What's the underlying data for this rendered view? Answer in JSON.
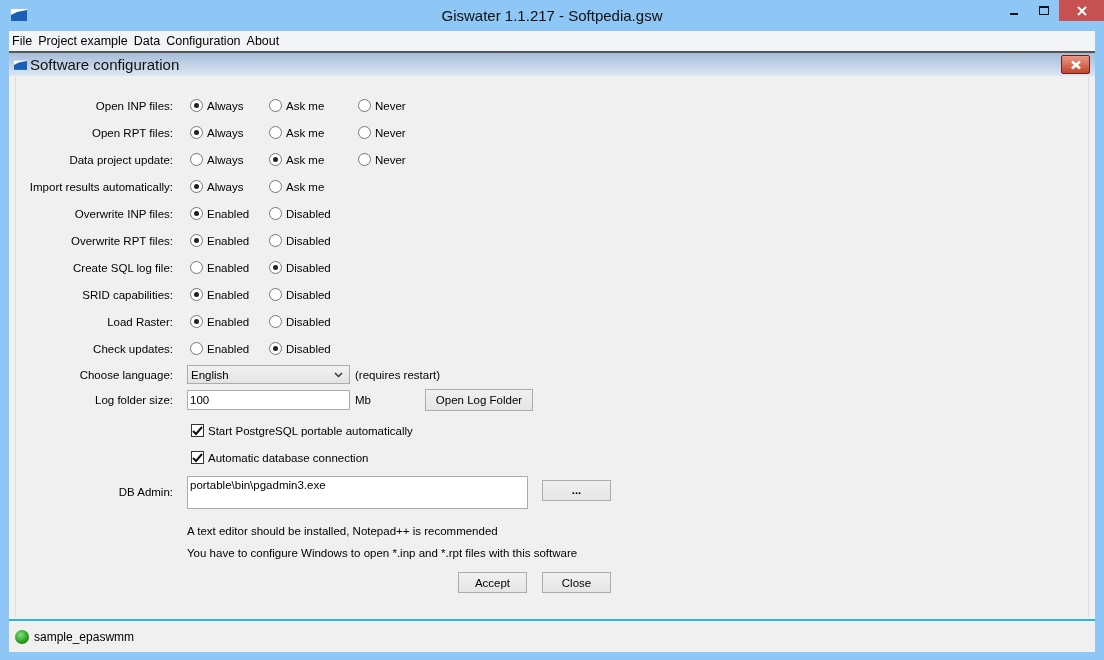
{
  "window": {
    "title": "Giswater 1.1.217 - Softpedia.gsw"
  },
  "menu": [
    "File",
    "Project example",
    "Data",
    "Configuration",
    "About"
  ],
  "dialog": {
    "title": "Software configuration"
  },
  "radio_rows": [
    {
      "label": "Open INP files:",
      "options": [
        {
          "label": "Always",
          "selected": true
        },
        {
          "label": "Ask me",
          "selected": false
        },
        {
          "label": "Never",
          "selected": false
        }
      ]
    },
    {
      "label": "Open RPT files:",
      "options": [
        {
          "label": "Always",
          "selected": true
        },
        {
          "label": "Ask me",
          "selected": false
        },
        {
          "label": "Never",
          "selected": false
        }
      ]
    },
    {
      "label": "Data project update:",
      "options": [
        {
          "label": "Always",
          "selected": false
        },
        {
          "label": "Ask me",
          "selected": true
        },
        {
          "label": "Never",
          "selected": false
        }
      ]
    },
    {
      "label": "Import results automatically:",
      "options": [
        {
          "label": "Always",
          "selected": true
        },
        {
          "label": "Ask me",
          "selected": false
        }
      ]
    },
    {
      "label": "Overwrite INP files:",
      "options": [
        {
          "label": "Enabled",
          "selected": true
        },
        {
          "label": "Disabled",
          "selected": false
        }
      ]
    },
    {
      "label": "Overwrite RPT files:",
      "options": [
        {
          "label": "Enabled",
          "selected": true
        },
        {
          "label": "Disabled",
          "selected": false
        }
      ]
    },
    {
      "label": "Create SQL log file:",
      "options": [
        {
          "label": "Enabled",
          "selected": false
        },
        {
          "label": "Disabled",
          "selected": true
        }
      ]
    },
    {
      "label": "SRID capabilities:",
      "options": [
        {
          "label": "Enabled",
          "selected": true
        },
        {
          "label": "Disabled",
          "selected": false
        }
      ]
    },
    {
      "label": "Load Raster:",
      "options": [
        {
          "label": "Enabled",
          "selected": true
        },
        {
          "label": "Disabled",
          "selected": false
        }
      ]
    },
    {
      "label": "Check updates:",
      "options": [
        {
          "label": "Enabled",
          "selected": false
        },
        {
          "label": "Disabled",
          "selected": true
        }
      ]
    }
  ],
  "language": {
    "label": "Choose language:",
    "value": "English",
    "note": "(requires restart)"
  },
  "log_folder": {
    "label": "Log folder size:",
    "value": "100",
    "unit": "Mb",
    "button": "Open Log Folder"
  },
  "checkboxes": [
    {
      "label": "Start PostgreSQL portable automatically",
      "checked": true
    },
    {
      "label": "Automatic database connection",
      "checked": true
    }
  ],
  "db_admin": {
    "label": "DB Admin:",
    "value": "portable\\bin\\pgadmin3.exe",
    "button": "..."
  },
  "notes": [
    "A text editor should be installed, Notepad++ is recommended",
    "You have to configure Windows to open *.inp and *.rpt files with this software"
  ],
  "buttons": [
    "Accept",
    "Close"
  ],
  "status_bar": {
    "project": "sample_epaswmm"
  }
}
